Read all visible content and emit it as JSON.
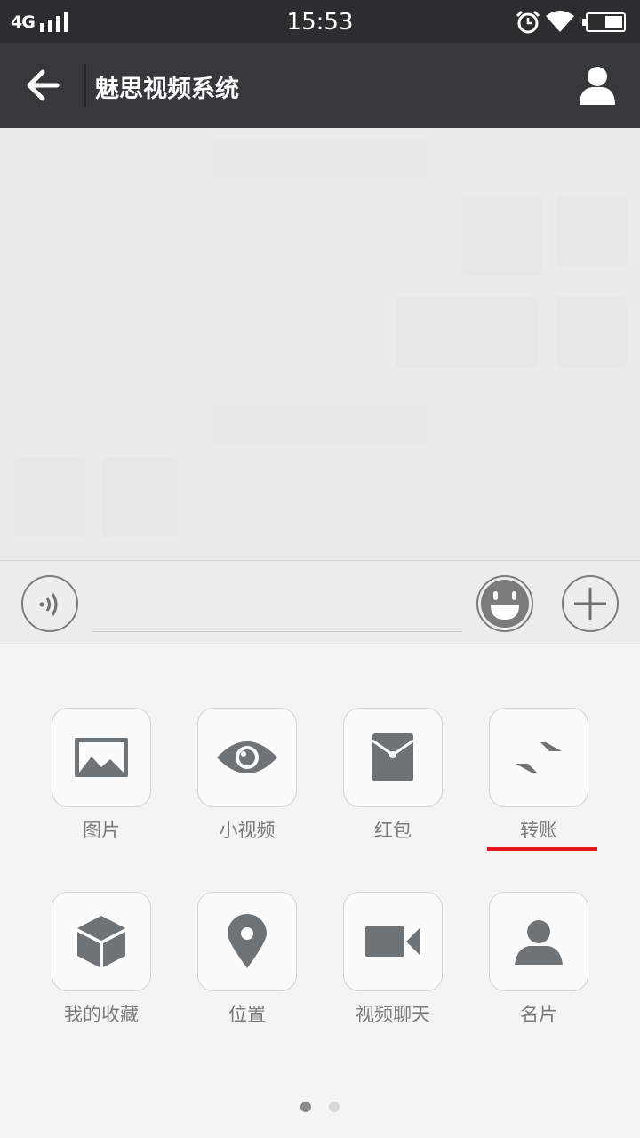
{
  "status_bar": {
    "network": "4G",
    "time": "15:53"
  },
  "header": {
    "title": "魅思视频系统"
  },
  "panel": {
    "items": [
      {
        "label": "图片",
        "icon": "picture-icon"
      },
      {
        "label": "小视频",
        "icon": "eye-icon"
      },
      {
        "label": "红包",
        "icon": "red-packet-icon"
      },
      {
        "label": "转账",
        "icon": "transfer-icon"
      },
      {
        "label": "我的收藏",
        "icon": "box-icon"
      },
      {
        "label": "位置",
        "icon": "location-pin-icon"
      },
      {
        "label": "视频聊天",
        "icon": "video-camera-icon"
      },
      {
        "label": "名片",
        "icon": "person-card-icon"
      }
    ],
    "page_count": 2,
    "active_page": 1
  },
  "colors": {
    "title_bar": "#35393c",
    "status_bar": "#2b2d2f",
    "icon_gray": "#6e7378",
    "highlight": "#e8141b"
  }
}
